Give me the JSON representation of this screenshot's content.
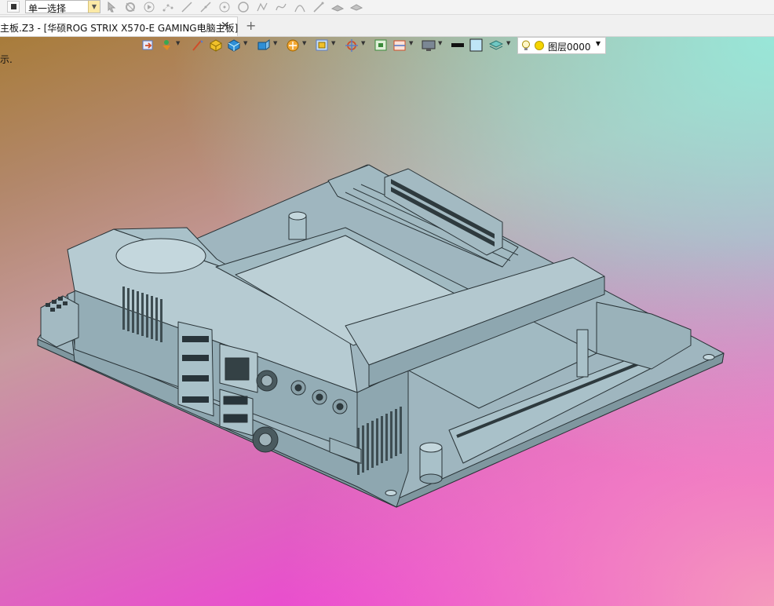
{
  "toolbar": {
    "selection_mode": "单一选择",
    "icons": [
      "stop-icon",
      "pointer-icon",
      "filter-icon",
      "play-icon",
      "points-icon",
      "line-icon",
      "arrow-line-icon",
      "circle-dot-icon",
      "circle-icon",
      "polyline-icon",
      "spline-icon",
      "arc-icon",
      "pen-icon",
      "hat-icon",
      "hat2-icon"
    ]
  },
  "tabs": {
    "active_title": "主板.Z3 - [华硕ROG STRIX X570-E GAMING电脑主板]",
    "close_glyph": "✕",
    "add_glyph": "+"
  },
  "viewport": {
    "prompt": "示."
  },
  "view_toolbar": {
    "layer_label": "图层0000",
    "icons": [
      "refresh-icon",
      "filter-view-icon",
      "pen-view-icon",
      "box-icon",
      "cube-icon",
      "cube-views-icon",
      "orbit-icon",
      "zoom-icon",
      "pan-icon",
      "fit-icon",
      "section-icon",
      "display-icon",
      "color-black-swatch",
      "color-light-swatch",
      "layers-icon"
    ]
  },
  "colors": {
    "model_fill": "#a9c3cc",
    "model_stroke": "#2a3438"
  }
}
